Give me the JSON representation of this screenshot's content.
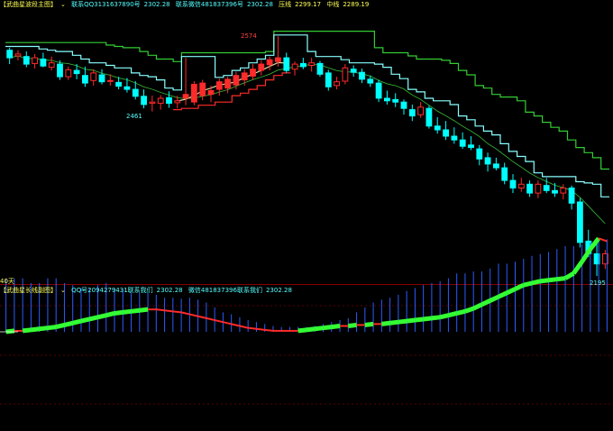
{
  "main_header": {
    "title": "【武曲星波段主图】",
    "caret": "⌄",
    "contact_qq": "联系QQ3131637890号",
    "contact_qq_value": "2302.28",
    "contact_wx": "联系微信481837396号",
    "contact_wx_value": "2302.28",
    "pressure_label": "压线",
    "pressure_value": "2299.17",
    "mid_label": "中线",
    "mid_value": "2289.19"
  },
  "sub_header": {
    "title": "【武曲星长线副图】",
    "caret": "⌄",
    "qq_label": "QQ号2094279431联系我们",
    "qq_value": "2302.28",
    "wx_label": "微信481837396联系我们",
    "wx_value": "2302.28"
  },
  "main_labels": {
    "high_mark": "2574",
    "low_mark": "2461",
    "bottom_mark": "2195",
    "period_label": "40天"
  },
  "colors": {
    "background": "#000000",
    "bull_candle": "#ff2a2a",
    "bear_candle": "#00ffff",
    "upper_band": "#33cc33",
    "mid_band": "#88ffff",
    "ma_line": "#d9d9a0",
    "stop_line": "#ff2a2a",
    "grid": "#b00000",
    "sub_bar": "#2b5cff",
    "osc_green": "#33ff33",
    "osc_red": "#ff2a2a"
  },
  "chart_data": {
    "type": "candlestick",
    "title": "武曲星波段主图",
    "ylim": [
      2195,
      2600
    ],
    "candles": [
      [
        2552,
        2556,
        2530,
        2540
      ],
      [
        2543,
        2552,
        2536,
        2546
      ],
      [
        2542,
        2550,
        2525,
        2530
      ],
      [
        2531,
        2546,
        2523,
        2540
      ],
      [
        2538,
        2548,
        2525,
        2527
      ],
      [
        2525,
        2542,
        2520,
        2532
      ],
      [
        2530,
        2536,
        2505,
        2510
      ],
      [
        2510,
        2526,
        2505,
        2521
      ],
      [
        2520,
        2530,
        2506,
        2515
      ],
      [
        2512,
        2526,
        2494,
        2500
      ],
      [
        2504,
        2522,
        2496,
        2516
      ],
      [
        2513,
        2522,
        2498,
        2502
      ],
      [
        2503,
        2514,
        2496,
        2504
      ],
      [
        2501,
        2510,
        2490,
        2495
      ],
      [
        2494,
        2508,
        2485,
        2490
      ],
      [
        2490,
        2503,
        2474,
        2479
      ],
      [
        2479,
        2490,
        2460,
        2466
      ],
      [
        2468,
        2480,
        2455,
        2470
      ],
      [
        2468,
        2481,
        2458,
        2476
      ],
      [
        2477,
        2487,
        2461,
        2468
      ],
      [
        2469,
        2480,
        2460,
        2472
      ],
      [
        2476,
        2540,
        2465,
        2482
      ],
      [
        2470,
        2503,
        2465,
        2498
      ],
      [
        2480,
        2505,
        2473,
        2500
      ],
      [
        2482,
        2496,
        2470,
        2488
      ],
      [
        2490,
        2507,
        2480,
        2502
      ],
      [
        2492,
        2510,
        2484,
        2506
      ],
      [
        2497,
        2518,
        2490,
        2512
      ],
      [
        2505,
        2522,
        2496,
        2516
      ],
      [
        2511,
        2530,
        2505,
        2522
      ],
      [
        2520,
        2536,
        2512,
        2530
      ],
      [
        2529,
        2542,
        2520,
        2537
      ],
      [
        2534,
        2574,
        2526,
        2540
      ],
      [
        2540,
        2548,
        2516,
        2520
      ],
      [
        2522,
        2534,
        2512,
        2530
      ],
      [
        2531,
        2540,
        2522,
        2526
      ],
      [
        2528,
        2540,
        2518,
        2532
      ],
      [
        2531,
        2535,
        2510,
        2514
      ],
      [
        2516,
        2521,
        2488,
        2494
      ],
      [
        2496,
        2510,
        2490,
        2502
      ],
      [
        2503,
        2530,
        2498,
        2524
      ],
      [
        2522,
        2528,
        2510,
        2517
      ],
      [
        2517,
        2523,
        2500,
        2506
      ],
      [
        2506,
        2512,
        2494,
        2500
      ],
      [
        2500,
        2505,
        2470,
        2476
      ],
      [
        2476,
        2488,
        2466,
        2472
      ],
      [
        2474,
        2484,
        2462,
        2470
      ],
      [
        2470,
        2474,
        2450,
        2460
      ],
      [
        2458,
        2466,
        2440,
        2448
      ],
      [
        2450,
        2470,
        2445,
        2462
      ],
      [
        2460,
        2464,
        2428,
        2432
      ],
      [
        2432,
        2446,
        2420,
        2426
      ],
      [
        2426,
        2440,
        2410,
        2416
      ],
      [
        2416,
        2430,
        2404,
        2410
      ],
      [
        2410,
        2422,
        2396,
        2400
      ],
      [
        2402,
        2416,
        2394,
        2398
      ],
      [
        2396,
        2402,
        2370,
        2380
      ],
      [
        2382,
        2390,
        2360,
        2372
      ],
      [
        2372,
        2382,
        2362,
        2366
      ],
      [
        2366,
        2374,
        2340,
        2346
      ],
      [
        2346,
        2356,
        2326,
        2334
      ],
      [
        2334,
        2350,
        2328,
        2340
      ],
      [
        2340,
        2346,
        2320,
        2326
      ],
      [
        2326,
        2346,
        2318,
        2340
      ],
      [
        2338,
        2350,
        2326,
        2330
      ],
      [
        2330,
        2342,
        2320,
        2326
      ],
      [
        2326,
        2340,
        2316,
        2334
      ],
      [
        2334,
        2338,
        2300,
        2310
      ],
      [
        2312,
        2318,
        2240,
        2248
      ],
      [
        2250,
        2268,
        2225,
        2230
      ],
      [
        2230,
        2246,
        2195,
        2214
      ],
      [
        2214,
        2236,
        2206,
        2230
      ]
    ],
    "levels": {
      "high": 2574,
      "low": 2461,
      "bottom": 2195
    },
    "sub_chart": {
      "title": "武曲星长线副图",
      "baseline": 0,
      "ylim": [
        -100,
        0
      ],
      "osc": [
        0,
        -1,
        -1,
        -2,
        -3,
        -4,
        -5,
        -7,
        -9,
        -11,
        -13,
        -15,
        -17,
        -19,
        -20,
        -21,
        -22,
        -23,
        -23,
        -22,
        -21,
        -20,
        -18,
        -16,
        -14,
        -12,
        -10,
        -8,
        -6,
        -4,
        -3,
        -2,
        -1,
        -1,
        -1,
        -1,
        -2,
        -3,
        -4,
        -5,
        -6,
        -6,
        -7,
        -7,
        -8,
        -8,
        -9,
        -10,
        -11,
        -12,
        -13,
        -14,
        -15,
        -17,
        -19,
        -21,
        -24,
        -28,
        -32,
        -36,
        -40,
        -44,
        -48,
        -50,
        -52,
        -53,
        -54,
        -55,
        -60,
        -72,
        -85,
        -96,
        -93
      ],
      "bars": [
        -55,
        -55,
        -55,
        -50,
        -50,
        -55,
        -55,
        -50,
        -48,
        -45,
        -45,
        -48,
        -50,
        -45,
        -44,
        -40,
        -40,
        -40,
        -38,
        -35,
        -35,
        -34,
        -35,
        -33,
        -30,
        -25,
        -20,
        -18,
        -15,
        -12,
        -10,
        -8,
        -6,
        -5,
        -5,
        -5,
        -5,
        -6,
        -8,
        -10,
        -12,
        -14,
        -20,
        -25,
        -30,
        -33,
        -35,
        -38,
        -42,
        -45,
        -48,
        -50,
        -52,
        -55,
        -60,
        -60,
        -62,
        -62,
        -65,
        -70,
        -70,
        -72,
        -75,
        -78,
        -80,
        -82,
        -85,
        -88,
        -88,
        -90,
        -92,
        -93,
        -95
      ]
    }
  }
}
